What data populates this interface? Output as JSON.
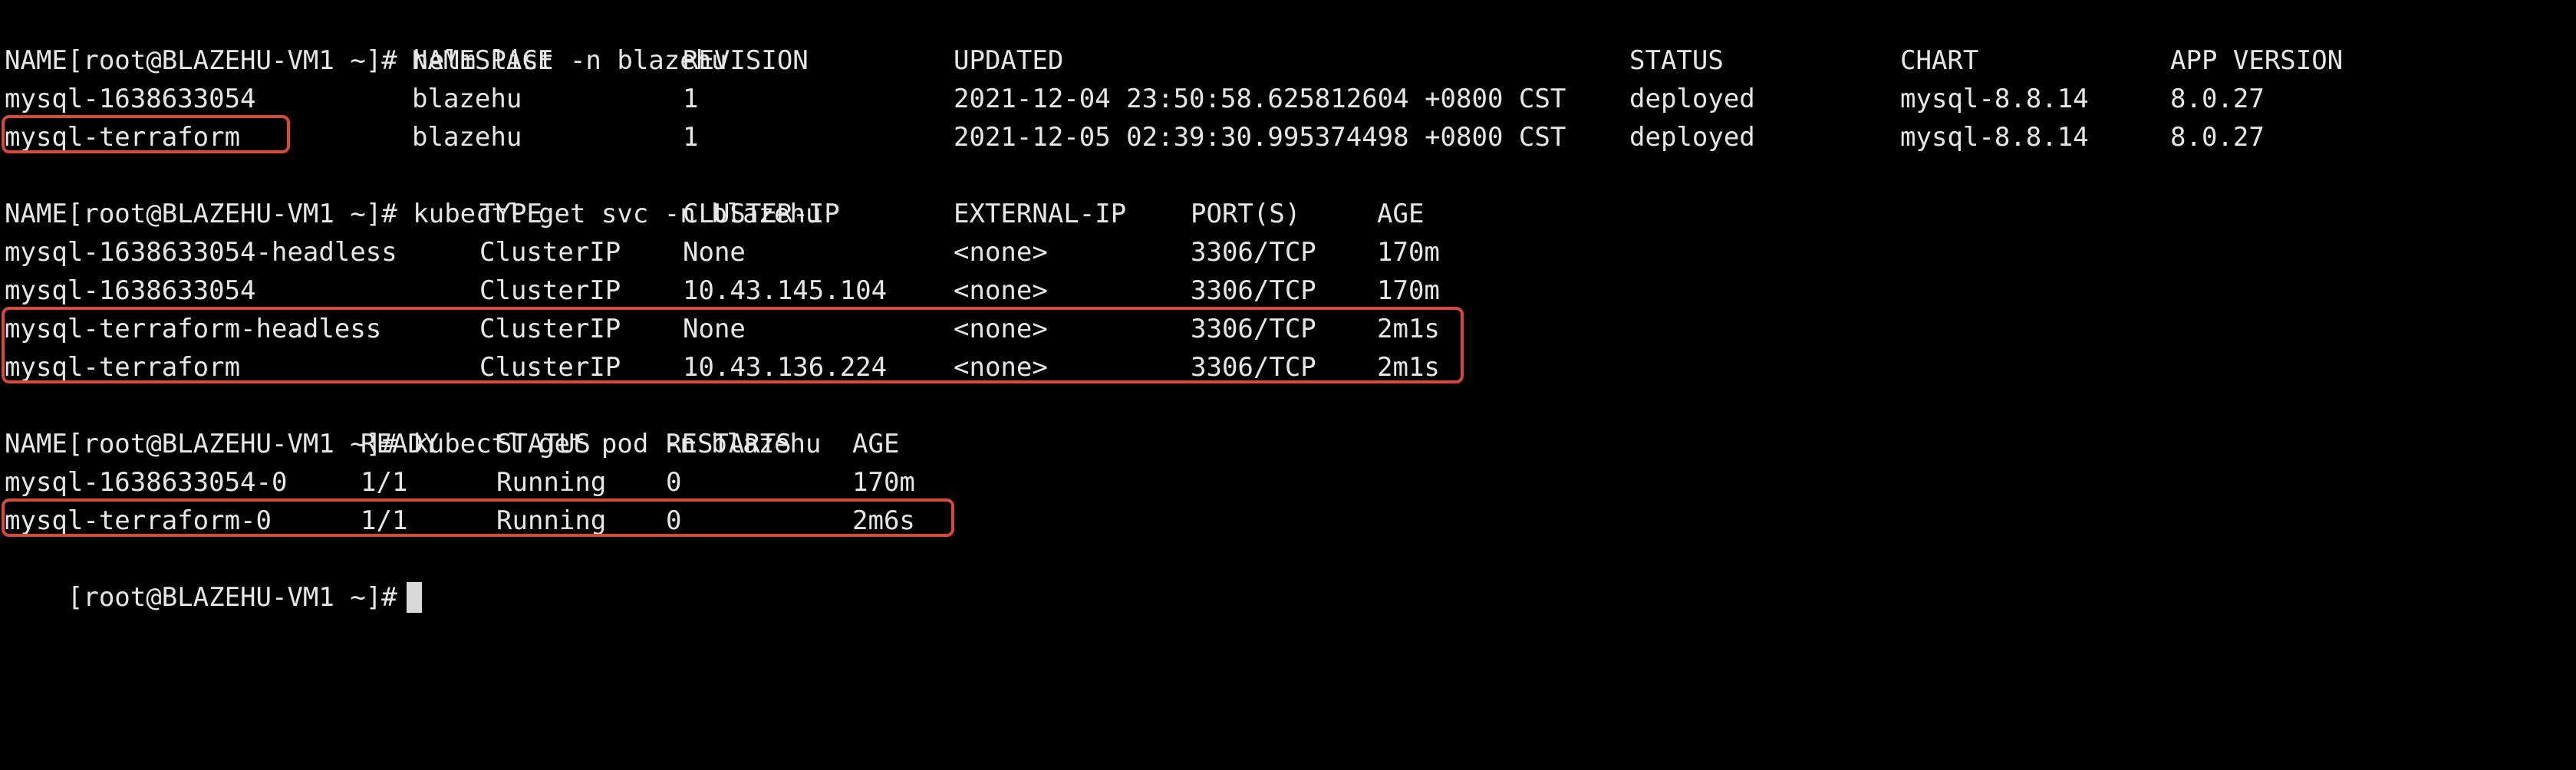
{
  "terminal": {
    "prompt": "[root@BLAZEHU-VM1 ~]#",
    "cmd_helm": "helm list -n blazehu",
    "cmd_svc": "kubectl get svc -n blazehu",
    "cmd_pod": "kubectl get pod -n blazehu",
    "highlight_color": "#d64a3c",
    "cursor_color": "#d9d9d9"
  },
  "helm": {
    "headers": [
      "NAME",
      "NAMESPACE",
      "REVISION",
      "UPDATED",
      "STATUS",
      "CHART",
      "APP VERSION"
    ],
    "rows": [
      [
        "mysql-1638633054",
        "blazehu",
        "1",
        "2021-12-04 23:50:58.625812604 +0800 CST",
        "deployed",
        "mysql-8.8.14",
        "8.0.27"
      ],
      [
        "mysql-terraform",
        "blazehu",
        "1",
        "2021-12-05 02:39:30.995374498 +0800 CST",
        "deployed",
        "mysql-8.8.14",
        "8.0.27"
      ]
    ]
  },
  "svc": {
    "headers": [
      "NAME",
      "TYPE",
      "CLUSTER-IP",
      "EXTERNAL-IP",
      "PORT(S)",
      "AGE"
    ],
    "rows": [
      [
        "mysql-1638633054-headless",
        "ClusterIP",
        "None",
        "<none>",
        "3306/TCP",
        "170m"
      ],
      [
        "mysql-1638633054",
        "ClusterIP",
        "10.43.145.104",
        "<none>",
        "3306/TCP",
        "170m"
      ],
      [
        "mysql-terraform-headless",
        "ClusterIP",
        "None",
        "<none>",
        "3306/TCP",
        "2m1s"
      ],
      [
        "mysql-terraform",
        "ClusterIP",
        "10.43.136.224",
        "<none>",
        "3306/TCP",
        "2m1s"
      ]
    ]
  },
  "pod": {
    "headers": [
      "NAME",
      "READY",
      "STATUS",
      "RESTARTS",
      "AGE"
    ],
    "rows": [
      [
        "mysql-1638633054-0",
        "1/1",
        "Running",
        "0",
        "170m"
      ],
      [
        "mysql-terraform-0",
        "1/1",
        "Running",
        "0",
        "2m6s"
      ]
    ]
  }
}
